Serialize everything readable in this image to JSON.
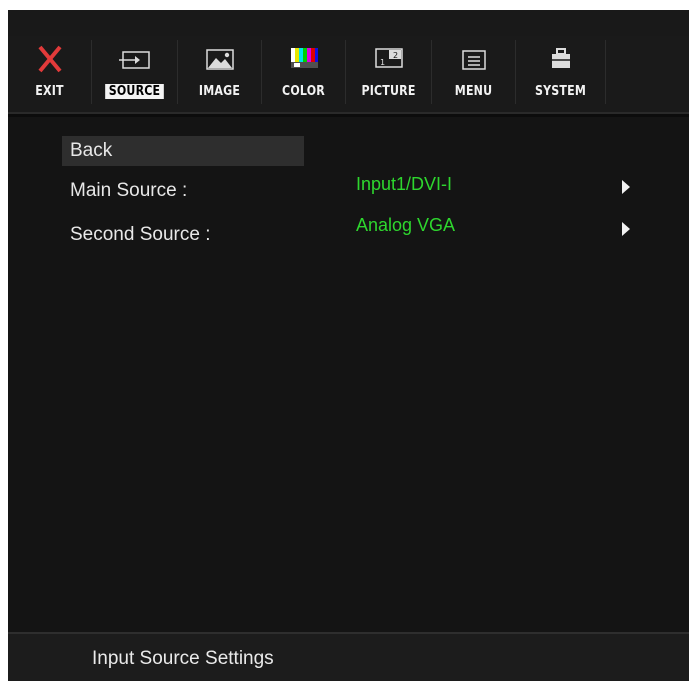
{
  "toolbar": {
    "tabs": [
      {
        "label": "EXIT",
        "icon": "close-x-icon"
      },
      {
        "label": "SOURCE",
        "icon": "input-source-icon",
        "active": true
      },
      {
        "label": "IMAGE",
        "icon": "picture-landscape-icon"
      },
      {
        "label": "COLOR",
        "icon": "color-bars-icon"
      },
      {
        "label": "PICTURE",
        "icon": "picture-in-picture-icon"
      },
      {
        "label": "MENU",
        "icon": "menu-window-icon"
      },
      {
        "label": "SYSTEM",
        "icon": "briefcase-icon"
      }
    ]
  },
  "menu": {
    "back_label": "Back",
    "main_source": {
      "label": "Main Source :",
      "value": "Input1/DVI-I"
    },
    "second_source": {
      "label": "Second Source :",
      "value": "Analog VGA"
    }
  },
  "footer": {
    "status": "Input Source Settings"
  },
  "colors": {
    "value_green": "#2ed62e",
    "exit_red": "#e23a3a",
    "background": "#141414"
  }
}
